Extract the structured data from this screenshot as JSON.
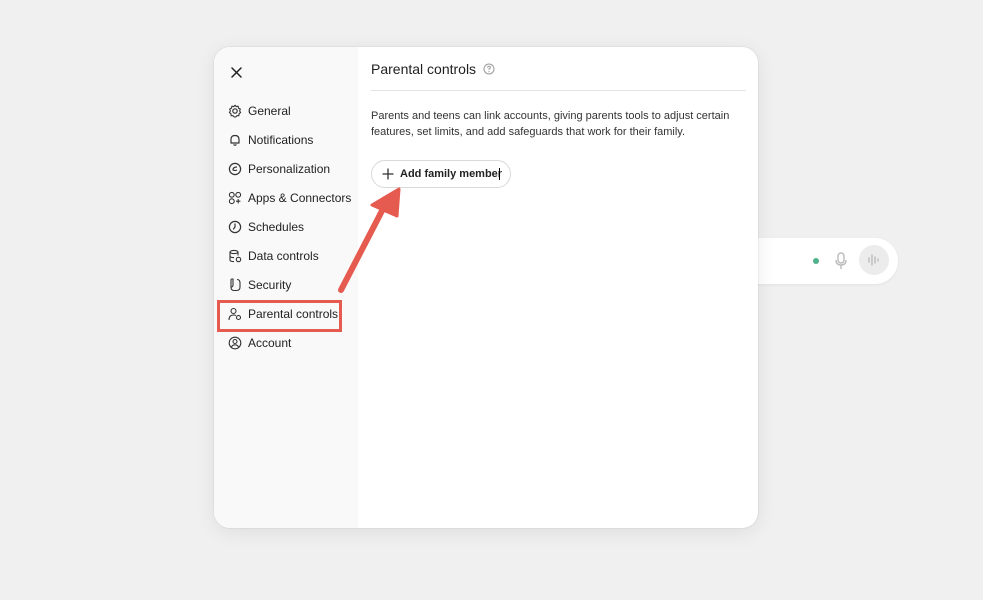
{
  "modal": {
    "close_icon": "close-icon",
    "sidebar": {
      "items": [
        {
          "label": "General",
          "icon": "gear-icon"
        },
        {
          "label": "Notifications",
          "icon": "bell-icon"
        },
        {
          "label": "Personalization",
          "icon": "personalization-icon"
        },
        {
          "label": "Apps & Connectors",
          "icon": "apps-icon"
        },
        {
          "label": "Schedules",
          "icon": "clock-icon"
        },
        {
          "label": "Data controls",
          "icon": "database-icon"
        },
        {
          "label": "Security",
          "icon": "shield-icon"
        },
        {
          "label": "Parental controls",
          "icon": "parental-icon",
          "active": true
        },
        {
          "label": "Account",
          "icon": "account-icon"
        }
      ]
    },
    "content": {
      "title": "Parental controls",
      "description": "Parents and teens can link accounts, giving parents tools to adjust certain features, set limits, and add safeguards that work for their family.",
      "add_button_label": "Add family member"
    }
  },
  "annotation": {
    "color": "#e65b4f"
  },
  "colors": {
    "accent": "#e65b4f",
    "status_dot": "#4fb38a"
  }
}
